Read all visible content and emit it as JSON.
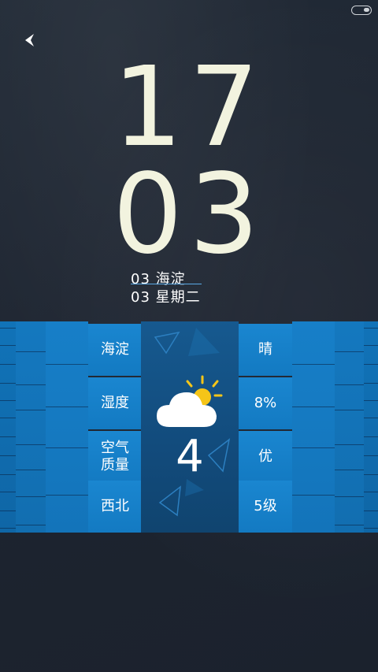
{
  "clock": {
    "hour": "17",
    "minute": "03"
  },
  "date": {
    "line1": "03 海淀",
    "line2": "03 星期二"
  },
  "weather": {
    "temperature": "4",
    "icon": "partly-cloudy-icon",
    "left_cells": [
      "海淀",
      "湿度",
      "空气\n质量",
      "西北"
    ],
    "right_cells": [
      "晴",
      "8%",
      "优",
      "5级"
    ]
  },
  "colors": {
    "accent": "#1a86d0",
    "clock_text": "#f2f3df",
    "background": "#1f2733",
    "sun": "#f5c518"
  },
  "icons": {
    "back": "back-arrow-icon",
    "toggle": "toggle-icon"
  }
}
